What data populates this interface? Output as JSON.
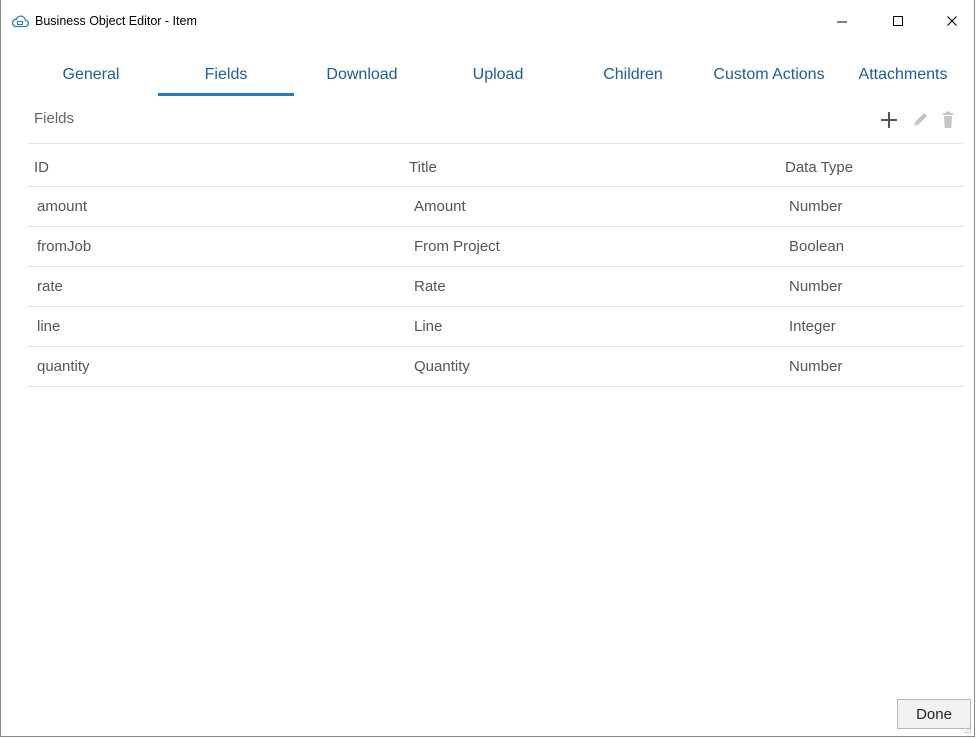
{
  "window": {
    "title": "Business Object Editor - Item",
    "icons": {
      "app": "cloud-icon",
      "minimize": "minimize-icon",
      "maximize": "maximize-icon",
      "close": "close-icon"
    }
  },
  "tabs": [
    {
      "label": "General",
      "active": false
    },
    {
      "label": "Fields",
      "active": true
    },
    {
      "label": "Download",
      "active": false
    },
    {
      "label": "Upload",
      "active": false
    },
    {
      "label": "Children",
      "active": false
    },
    {
      "label": "Custom Actions",
      "active": false
    },
    {
      "label": "Attachments",
      "active": false
    }
  ],
  "fields_section": {
    "title": "Fields",
    "toolbar_icons": [
      "plus-icon",
      "pencil-icon",
      "trash-icon"
    ],
    "columns": [
      "ID",
      "Title",
      "Data Type"
    ],
    "rows": [
      {
        "id": "amount",
        "title": "Amount",
        "type": "Number"
      },
      {
        "id": "fromJob",
        "title": "From Project",
        "type": "Boolean"
      },
      {
        "id": "rate",
        "title": "Rate",
        "type": "Number"
      },
      {
        "id": "line",
        "title": "Line",
        "type": "Integer"
      },
      {
        "id": "quantity",
        "title": "Quantity",
        "type": "Number"
      }
    ]
  },
  "footer": {
    "done_label": "Done"
  },
  "colors": {
    "accent": "#1e7ec4",
    "tab_text": "#1a5e9c",
    "muted_text": "#666666",
    "divider": "#e3e3e3"
  }
}
